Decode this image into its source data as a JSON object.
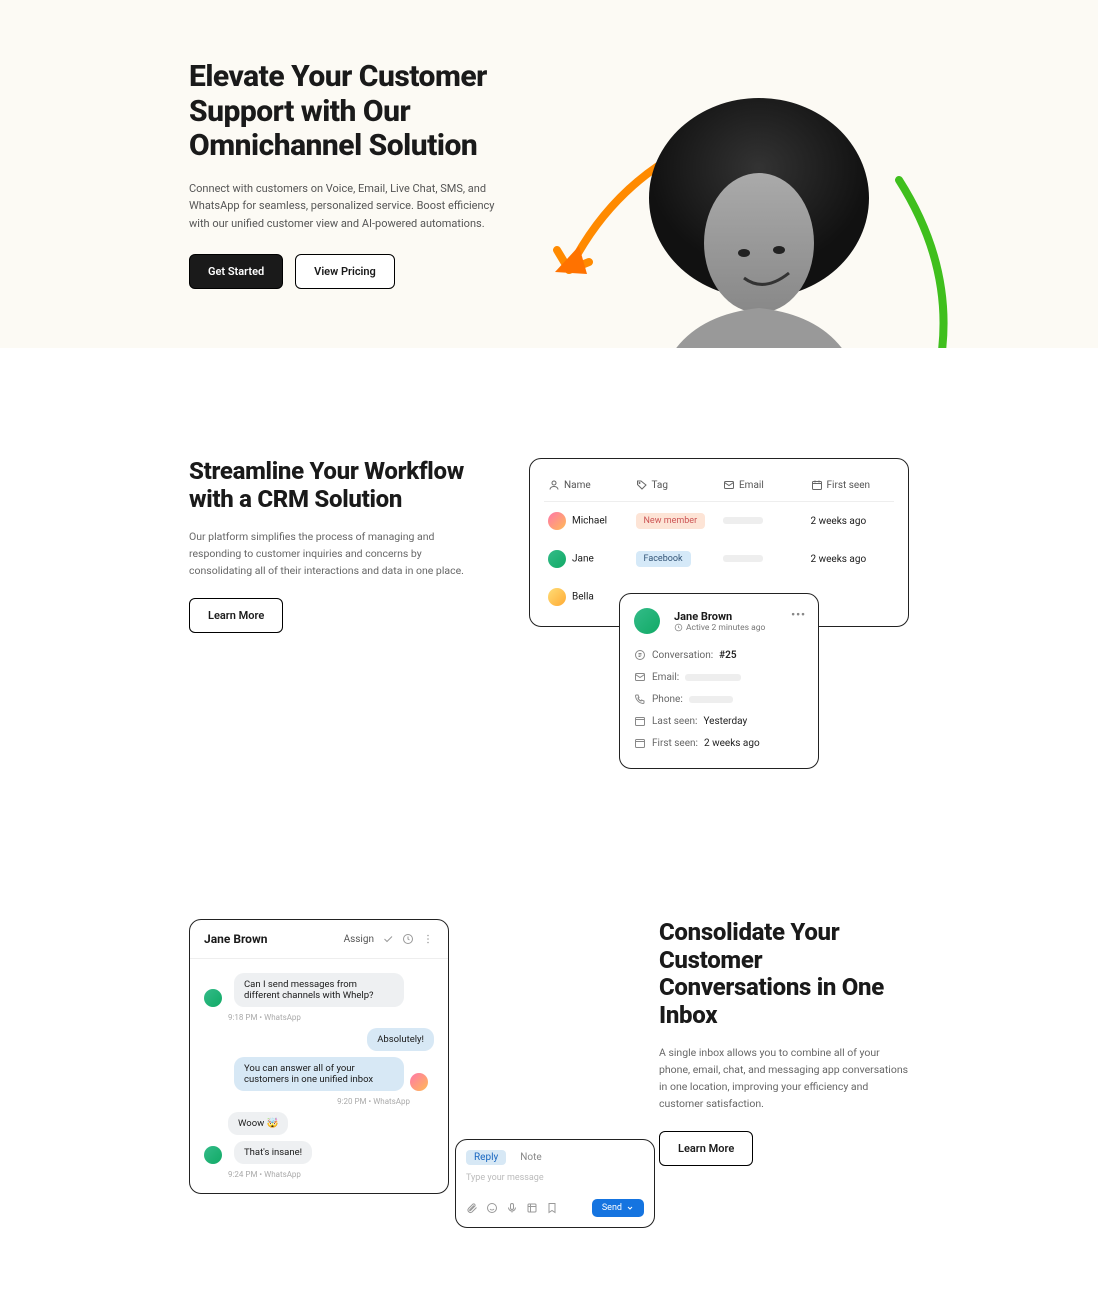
{
  "hero": {
    "title": "Elevate Your Customer Support with Our Omnichannel Solution",
    "subtitle": "Connect with customers on Voice, Email, Live Chat, SMS, and WhatsApp for seamless, personalized service. Boost efficiency with our unified customer view and AI-powered automations.",
    "cta_primary": "Get Started",
    "cta_secondary": "View Pricing"
  },
  "crm": {
    "title": "Streamline Your Workflow with a CRM Solution",
    "subtitle": "Our platform simplifies the process of managing and responding to customer inquiries and concerns by consolidating all of their interactions and data in one place.",
    "cta": "Learn More",
    "table": {
      "headers": {
        "name": "Name",
        "tag": "Tag",
        "email": "Email",
        "first_seen": "First seen"
      },
      "rows": [
        {
          "name": "Michael",
          "tag": "New member",
          "tag_style": "orange",
          "first_seen": "2 weeks ago",
          "avatar": "orange"
        },
        {
          "name": "Jane",
          "tag": "Facebook",
          "tag_style": "blue",
          "first_seen": "2 weeks ago",
          "avatar": "green"
        },
        {
          "name": "Bella",
          "tag": "",
          "tag_style": "",
          "first_seen": "",
          "avatar": "yellow"
        }
      ]
    },
    "detail": {
      "name": "Jane Brown",
      "status": "Active 2 minutes ago",
      "conversation_label": "Conversation:",
      "conversation_value": "#25",
      "email_label": "Email:",
      "phone_label": "Phone:",
      "last_seen_label": "Last seen:",
      "last_seen_value": "Yesterday",
      "first_seen_label": "First seen:",
      "first_seen_value": "2 weeks ago"
    }
  },
  "inbox": {
    "title": "Consolidate Your Customer Conversations in One Inbox",
    "subtitle": "A single inbox allows you to combine all of your phone, email, chat, and messaging app conversations in one location, improving your efficiency and customer satisfaction.",
    "cta": "Learn More",
    "chat": {
      "title": "Jane Brown",
      "assign": "Assign",
      "messages": [
        {
          "side": "left",
          "text": "Can I send messages from different channels with Whelp?",
          "time": "9:18 PM • WhatsApp"
        },
        {
          "side": "right",
          "text": "Absolutely!",
          "time": ""
        },
        {
          "side": "right",
          "text": "You can answer all of your customers in one unified inbox",
          "time": "9:20 PM • WhatsApp"
        },
        {
          "side": "left",
          "text": "Woow 🤯",
          "time": ""
        },
        {
          "side": "left",
          "text": "That's insane!",
          "time": "9:24 PM • WhatsApp"
        }
      ]
    },
    "compose": {
      "tab_reply": "Reply",
      "tab_note": "Note",
      "placeholder": "Type your message",
      "send": "Send"
    }
  }
}
